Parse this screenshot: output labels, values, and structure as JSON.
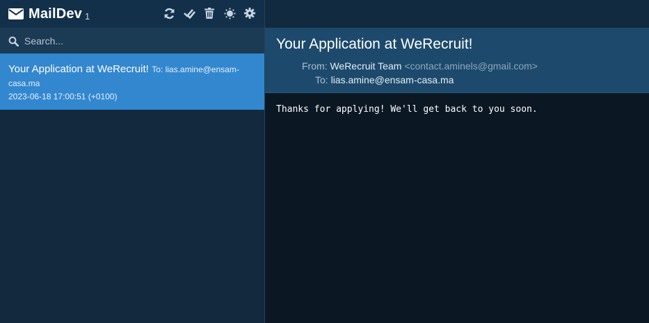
{
  "app": {
    "title": "MailDev",
    "count": "1"
  },
  "toolbar": {
    "icons": [
      "refresh-icon",
      "mark-all-read-icon",
      "delete-all-icon",
      "theme-icon",
      "settings-icon"
    ]
  },
  "search": {
    "placeholder": "Search..."
  },
  "emails": [
    {
      "subject": "Your Application at WeRecruit!",
      "to": "To: lias.amine@ensam-casa.ma",
      "date": "2023-06-18 17:00:51 (+0100)"
    }
  ],
  "selected_email": {
    "subject": "Your Application at WeRecruit!",
    "from_label": "From:",
    "from_name": "WeRecruit Team",
    "from_address": "<contact.aminels@gmail.com>",
    "to_label": "To:",
    "to_address": "lias.amine@ensam-casa.ma",
    "body": "Thanks for applying! We'll get back to you soon."
  },
  "colors": {
    "sidebar_bg": "#132a3e",
    "selected_item": "#3287cf",
    "header_bg": "#1d4a6c",
    "body_bg": "#0b1824"
  }
}
